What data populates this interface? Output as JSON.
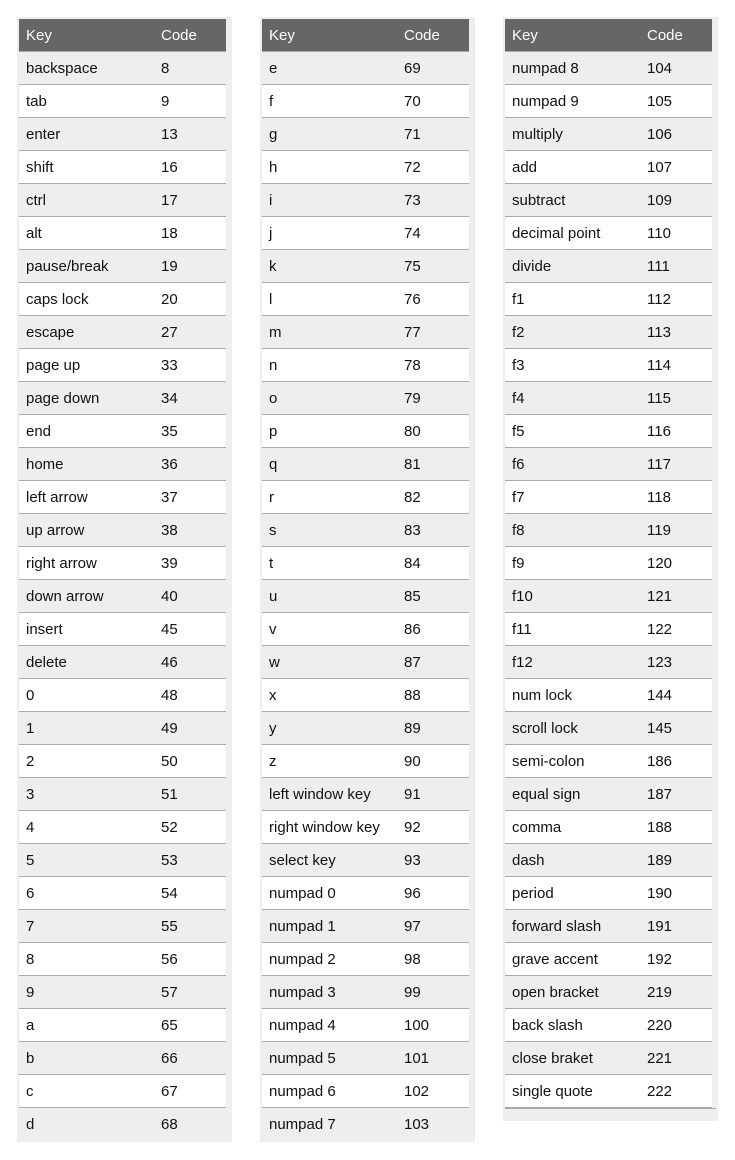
{
  "headers": {
    "key": "Key",
    "code": "Code"
  },
  "tables": [
    {
      "rows": [
        [
          "backspace",
          "8"
        ],
        [
          "tab",
          "9"
        ],
        [
          "enter",
          "13"
        ],
        [
          "shift",
          "16"
        ],
        [
          "ctrl",
          "17"
        ],
        [
          "alt",
          "18"
        ],
        [
          "pause/break",
          "19"
        ],
        [
          "caps lock",
          "20"
        ],
        [
          "escape",
          "27"
        ],
        [
          "page up",
          "33"
        ],
        [
          "page down",
          "34"
        ],
        [
          "end",
          "35"
        ],
        [
          "home",
          "36"
        ],
        [
          "left arrow",
          "37"
        ],
        [
          "up arrow",
          "38"
        ],
        [
          "right arrow",
          "39"
        ],
        [
          "down arrow",
          "40"
        ],
        [
          "insert",
          "45"
        ],
        [
          "delete",
          "46"
        ],
        [
          "0",
          "48"
        ],
        [
          "1",
          "49"
        ],
        [
          "2",
          "50"
        ],
        [
          "3",
          "51"
        ],
        [
          "4",
          "52"
        ],
        [
          "5",
          "53"
        ],
        [
          "6",
          "54"
        ],
        [
          "7",
          "55"
        ],
        [
          "8",
          "56"
        ],
        [
          "9",
          "57"
        ],
        [
          "a",
          "65"
        ],
        [
          "b",
          "66"
        ],
        [
          "c",
          "67"
        ],
        [
          "d",
          "68"
        ]
      ]
    },
    {
      "rows": [
        [
          "e",
          "69"
        ],
        [
          "f",
          "70"
        ],
        [
          "g",
          "71"
        ],
        [
          "h",
          "72"
        ],
        [
          "i",
          "73"
        ],
        [
          "j",
          "74"
        ],
        [
          "k",
          "75"
        ],
        [
          "l",
          "76"
        ],
        [
          "m",
          "77"
        ],
        [
          "n",
          "78"
        ],
        [
          "o",
          "79"
        ],
        [
          "p",
          "80"
        ],
        [
          "q",
          "81"
        ],
        [
          "r",
          "82"
        ],
        [
          "s",
          "83"
        ],
        [
          "t",
          "84"
        ],
        [
          "u",
          "85"
        ],
        [
          "v",
          "86"
        ],
        [
          "w",
          "87"
        ],
        [
          "x",
          "88"
        ],
        [
          "y",
          "89"
        ],
        [
          "z",
          "90"
        ],
        [
          "left window key",
          "91"
        ],
        [
          "right window key",
          "92"
        ],
        [
          "select key",
          "93"
        ],
        [
          "numpad 0",
          "96"
        ],
        [
          "numpad 1",
          "97"
        ],
        [
          "numpad 2",
          "98"
        ],
        [
          "numpad 3",
          "99"
        ],
        [
          "numpad 4",
          "100"
        ],
        [
          "numpad 5",
          "101"
        ],
        [
          "numpad 6",
          "102"
        ],
        [
          "numpad 7",
          "103"
        ]
      ]
    },
    {
      "rows": [
        [
          "numpad 8",
          "104"
        ],
        [
          "numpad 9",
          "105"
        ],
        [
          "multiply",
          "106"
        ],
        [
          "add",
          "107"
        ],
        [
          "subtract",
          "109"
        ],
        [
          "decimal point",
          "110"
        ],
        [
          "divide",
          "111"
        ],
        [
          "f1",
          "112"
        ],
        [
          "f2",
          "113"
        ],
        [
          "f3",
          "114"
        ],
        [
          "f4",
          "115"
        ],
        [
          "f5",
          "116"
        ],
        [
          "f6",
          "117"
        ],
        [
          "f7",
          "118"
        ],
        [
          "f8",
          "119"
        ],
        [
          "f9",
          "120"
        ],
        [
          "f10",
          "121"
        ],
        [
          "f11",
          "122"
        ],
        [
          "f12",
          "123"
        ],
        [
          "num lock",
          "144"
        ],
        [
          "scroll lock",
          "145"
        ],
        [
          "semi-colon",
          "186"
        ],
        [
          "equal sign",
          "187"
        ],
        [
          "comma",
          "188"
        ],
        [
          "dash",
          "189"
        ],
        [
          "period",
          "190"
        ],
        [
          "forward slash",
          "191"
        ],
        [
          "grave accent",
          "192"
        ],
        [
          "open bracket",
          "219"
        ],
        [
          "back slash",
          "220"
        ],
        [
          "close braket",
          "221"
        ],
        [
          "single quote",
          "222"
        ]
      ],
      "trailing_blank": true
    }
  ]
}
